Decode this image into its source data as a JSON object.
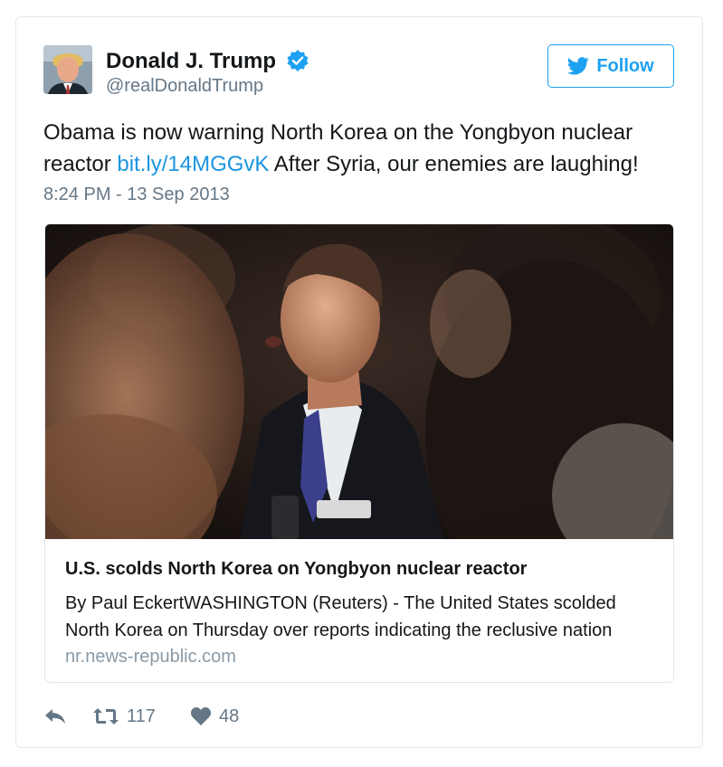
{
  "author": {
    "name": "Donald J. Trump",
    "handle": "@realDonaldTrump",
    "verified": true
  },
  "follow_button": {
    "label": "Follow",
    "icon": "twitter-bird-icon"
  },
  "tweet": {
    "text_before": "Obama is now warning North Korea on the Yongbyon nuclear reactor",
    "link": "bit.ly/14MGGvK",
    "text_after": "After Syria, our enemies are laughing!",
    "timestamp": "8:24 PM - 13 Sep 2013"
  },
  "card": {
    "title": "U.S. scolds North Korea on Yongbyon nuclear reactor",
    "description": "By Paul EckertWASHINGTON (Reuters) - The United States scolded North Korea on Thursday over reports indicating the reclusive nation",
    "domain": "nr.news-republic.com"
  },
  "actions": {
    "reply_icon": "reply-icon",
    "retweet_icon": "retweet-icon",
    "retweet_count": "117",
    "like_icon": "heart-icon",
    "like_count": "48"
  },
  "colors": {
    "accent": "#1da1f2",
    "link": "#1b95e0",
    "secondary_text": "#657786",
    "border": "#e1e8ed"
  }
}
